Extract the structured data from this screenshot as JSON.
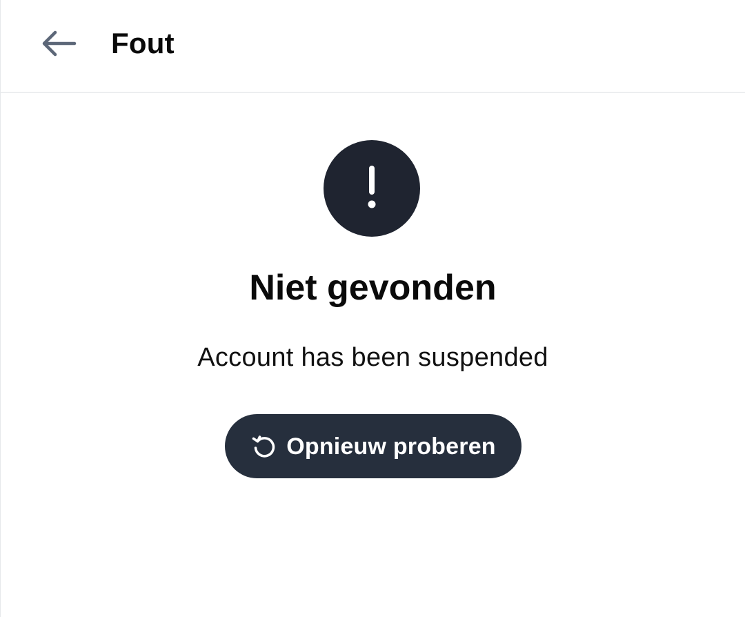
{
  "header": {
    "title": "Fout",
    "back_icon": "arrow-left-icon"
  },
  "error": {
    "icon": "exclamation-icon",
    "heading": "Niet gevonden",
    "message": "Account has been suspended"
  },
  "retry_button": {
    "icon": "refresh-icon",
    "label": "Opnieuw proberen"
  },
  "colors": {
    "icon_circle": "#1f2430",
    "button_background": "#262f3d",
    "back_arrow": "#5c6778",
    "divider": "#eceef0"
  }
}
